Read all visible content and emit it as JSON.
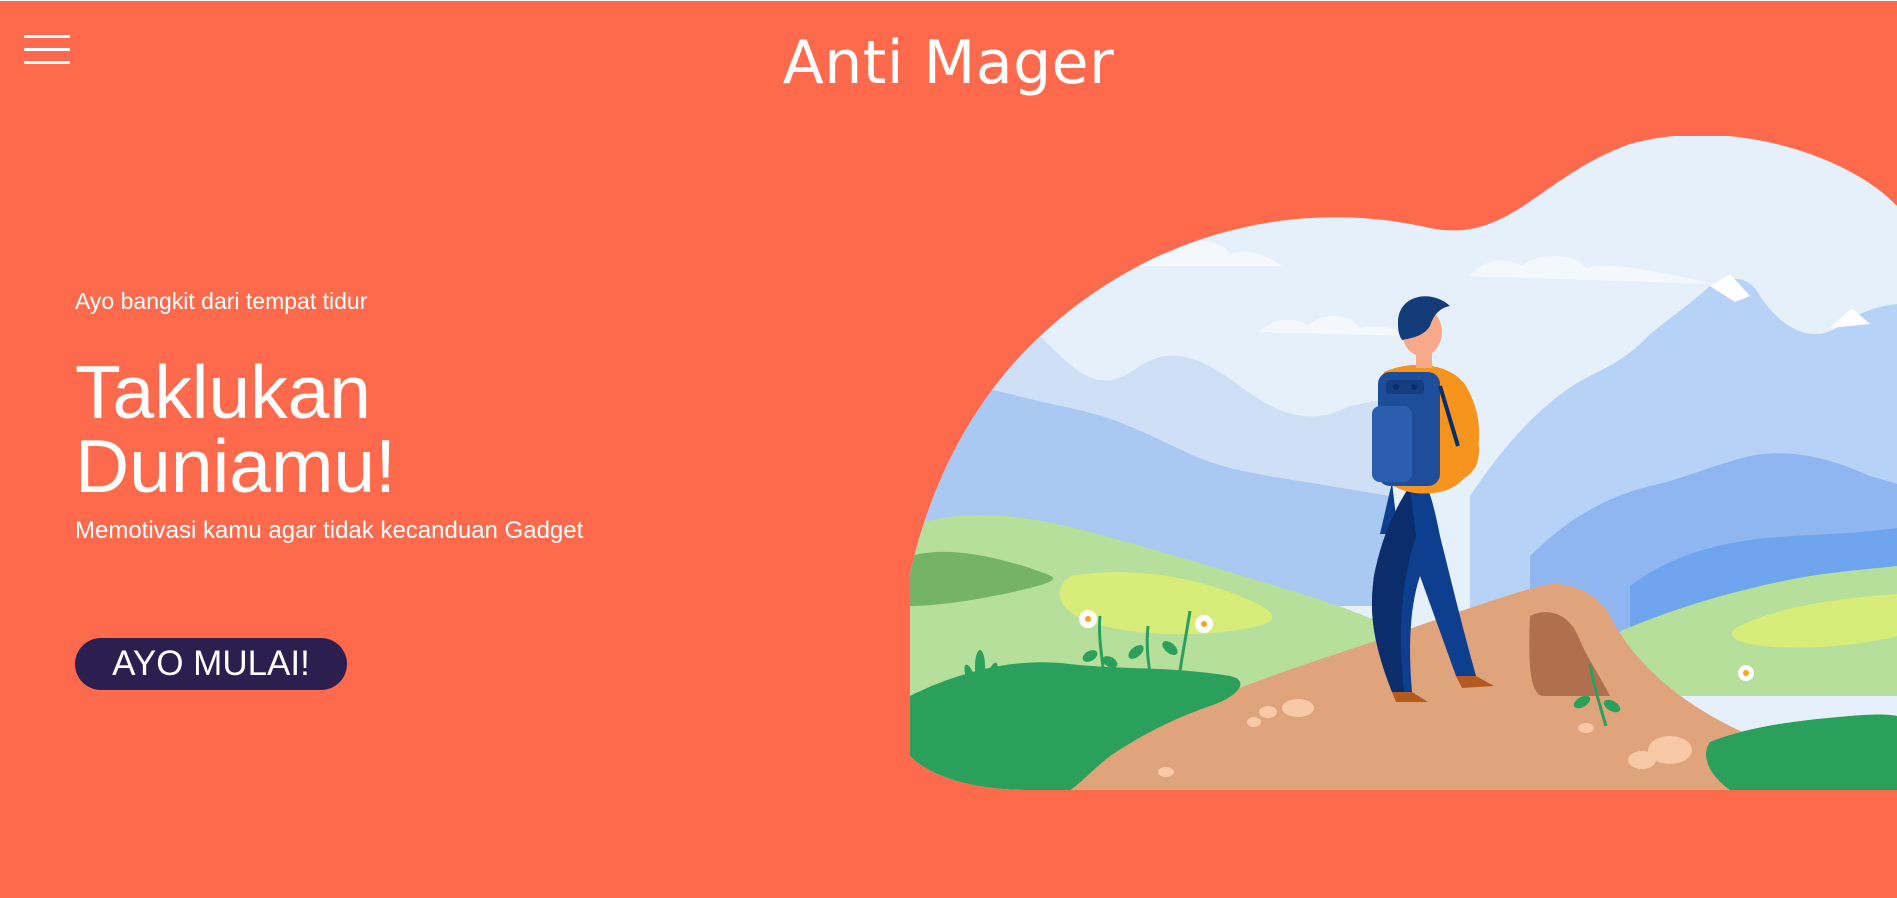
{
  "header": {
    "title": "Anti Mager",
    "menu_icon": "hamburger-menu-icon"
  },
  "hero": {
    "tagline": "Ayo bangkit dari tempat tidur",
    "headline_line1": "Taklukan",
    "headline_line2": "Duniamu!",
    "subtext": "Memotivasi kamu agar tidak kecanduan Gadget",
    "cta_label": "AYO MULAI!"
  },
  "colors": {
    "background": "#ff6a4d",
    "button": "#2c1e4f",
    "text": "#ffffff"
  }
}
